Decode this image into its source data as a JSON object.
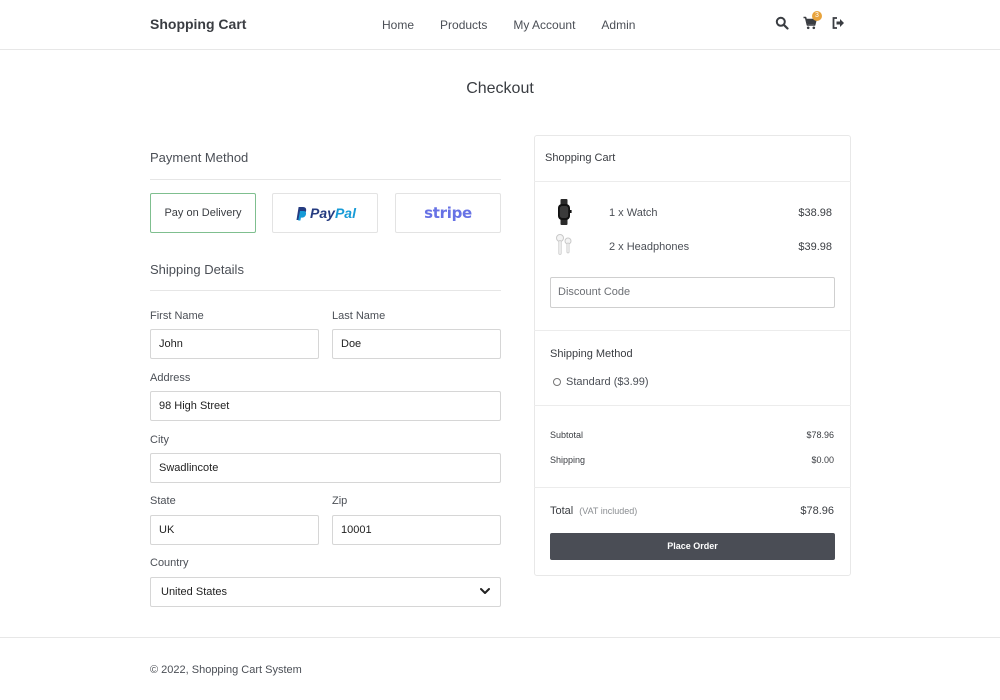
{
  "header": {
    "brand": "Shopping Cart",
    "nav": [
      "Home",
      "Products",
      "My Account",
      "Admin"
    ],
    "cart_count": "3",
    "icons": [
      "search-icon",
      "cart-icon",
      "sign-out-icon"
    ]
  },
  "page": {
    "title": "Checkout"
  },
  "payment": {
    "title": "Payment Method",
    "options": {
      "delivery": "Pay on Delivery",
      "paypal_a": "Pay",
      "paypal_b": "Pal",
      "stripe": "stripe"
    },
    "selected": "Pay on Delivery"
  },
  "shipping": {
    "title": "Shipping Details",
    "first_name_label": "First Name",
    "first_name": "John",
    "last_name_label": "Last Name",
    "last_name": "Doe",
    "address_label": "Address",
    "address": "98 High Street",
    "city_label": "City",
    "city": "Swadlincote",
    "state_label": "State",
    "state": "UK",
    "zip_label": "Zip",
    "zip": "10001",
    "country_label": "Country",
    "country": "United States"
  },
  "cart": {
    "title": "Shopping Cart",
    "items": [
      {
        "name": "1 x Watch",
        "price": "$38.98",
        "icon": "watch-icon"
      },
      {
        "name": "2 x Headphones",
        "price": "$39.98",
        "icon": "headphones-icon"
      }
    ],
    "discount_placeholder": "Discount Code",
    "shipping_method_title": "Shipping Method",
    "shipping_option": "Standard ($3.99)",
    "subtotal_label": "Subtotal",
    "subtotal": "$78.96",
    "shipping_label": "Shipping",
    "shipping": "$0.00",
    "total_label": "Total",
    "vat_note": "(VAT included)",
    "total": "$78.96",
    "place_order": "Place Order"
  },
  "footer": {
    "text": "© 2022, Shopping Cart System"
  },
  "colors": {
    "accent_border": "#7fbf8f",
    "badge": "#e8a33c",
    "button": "#4a4d55",
    "paypal_dark": "#253b80",
    "paypal_light": "#179bd7",
    "stripe": "#6772e5"
  }
}
